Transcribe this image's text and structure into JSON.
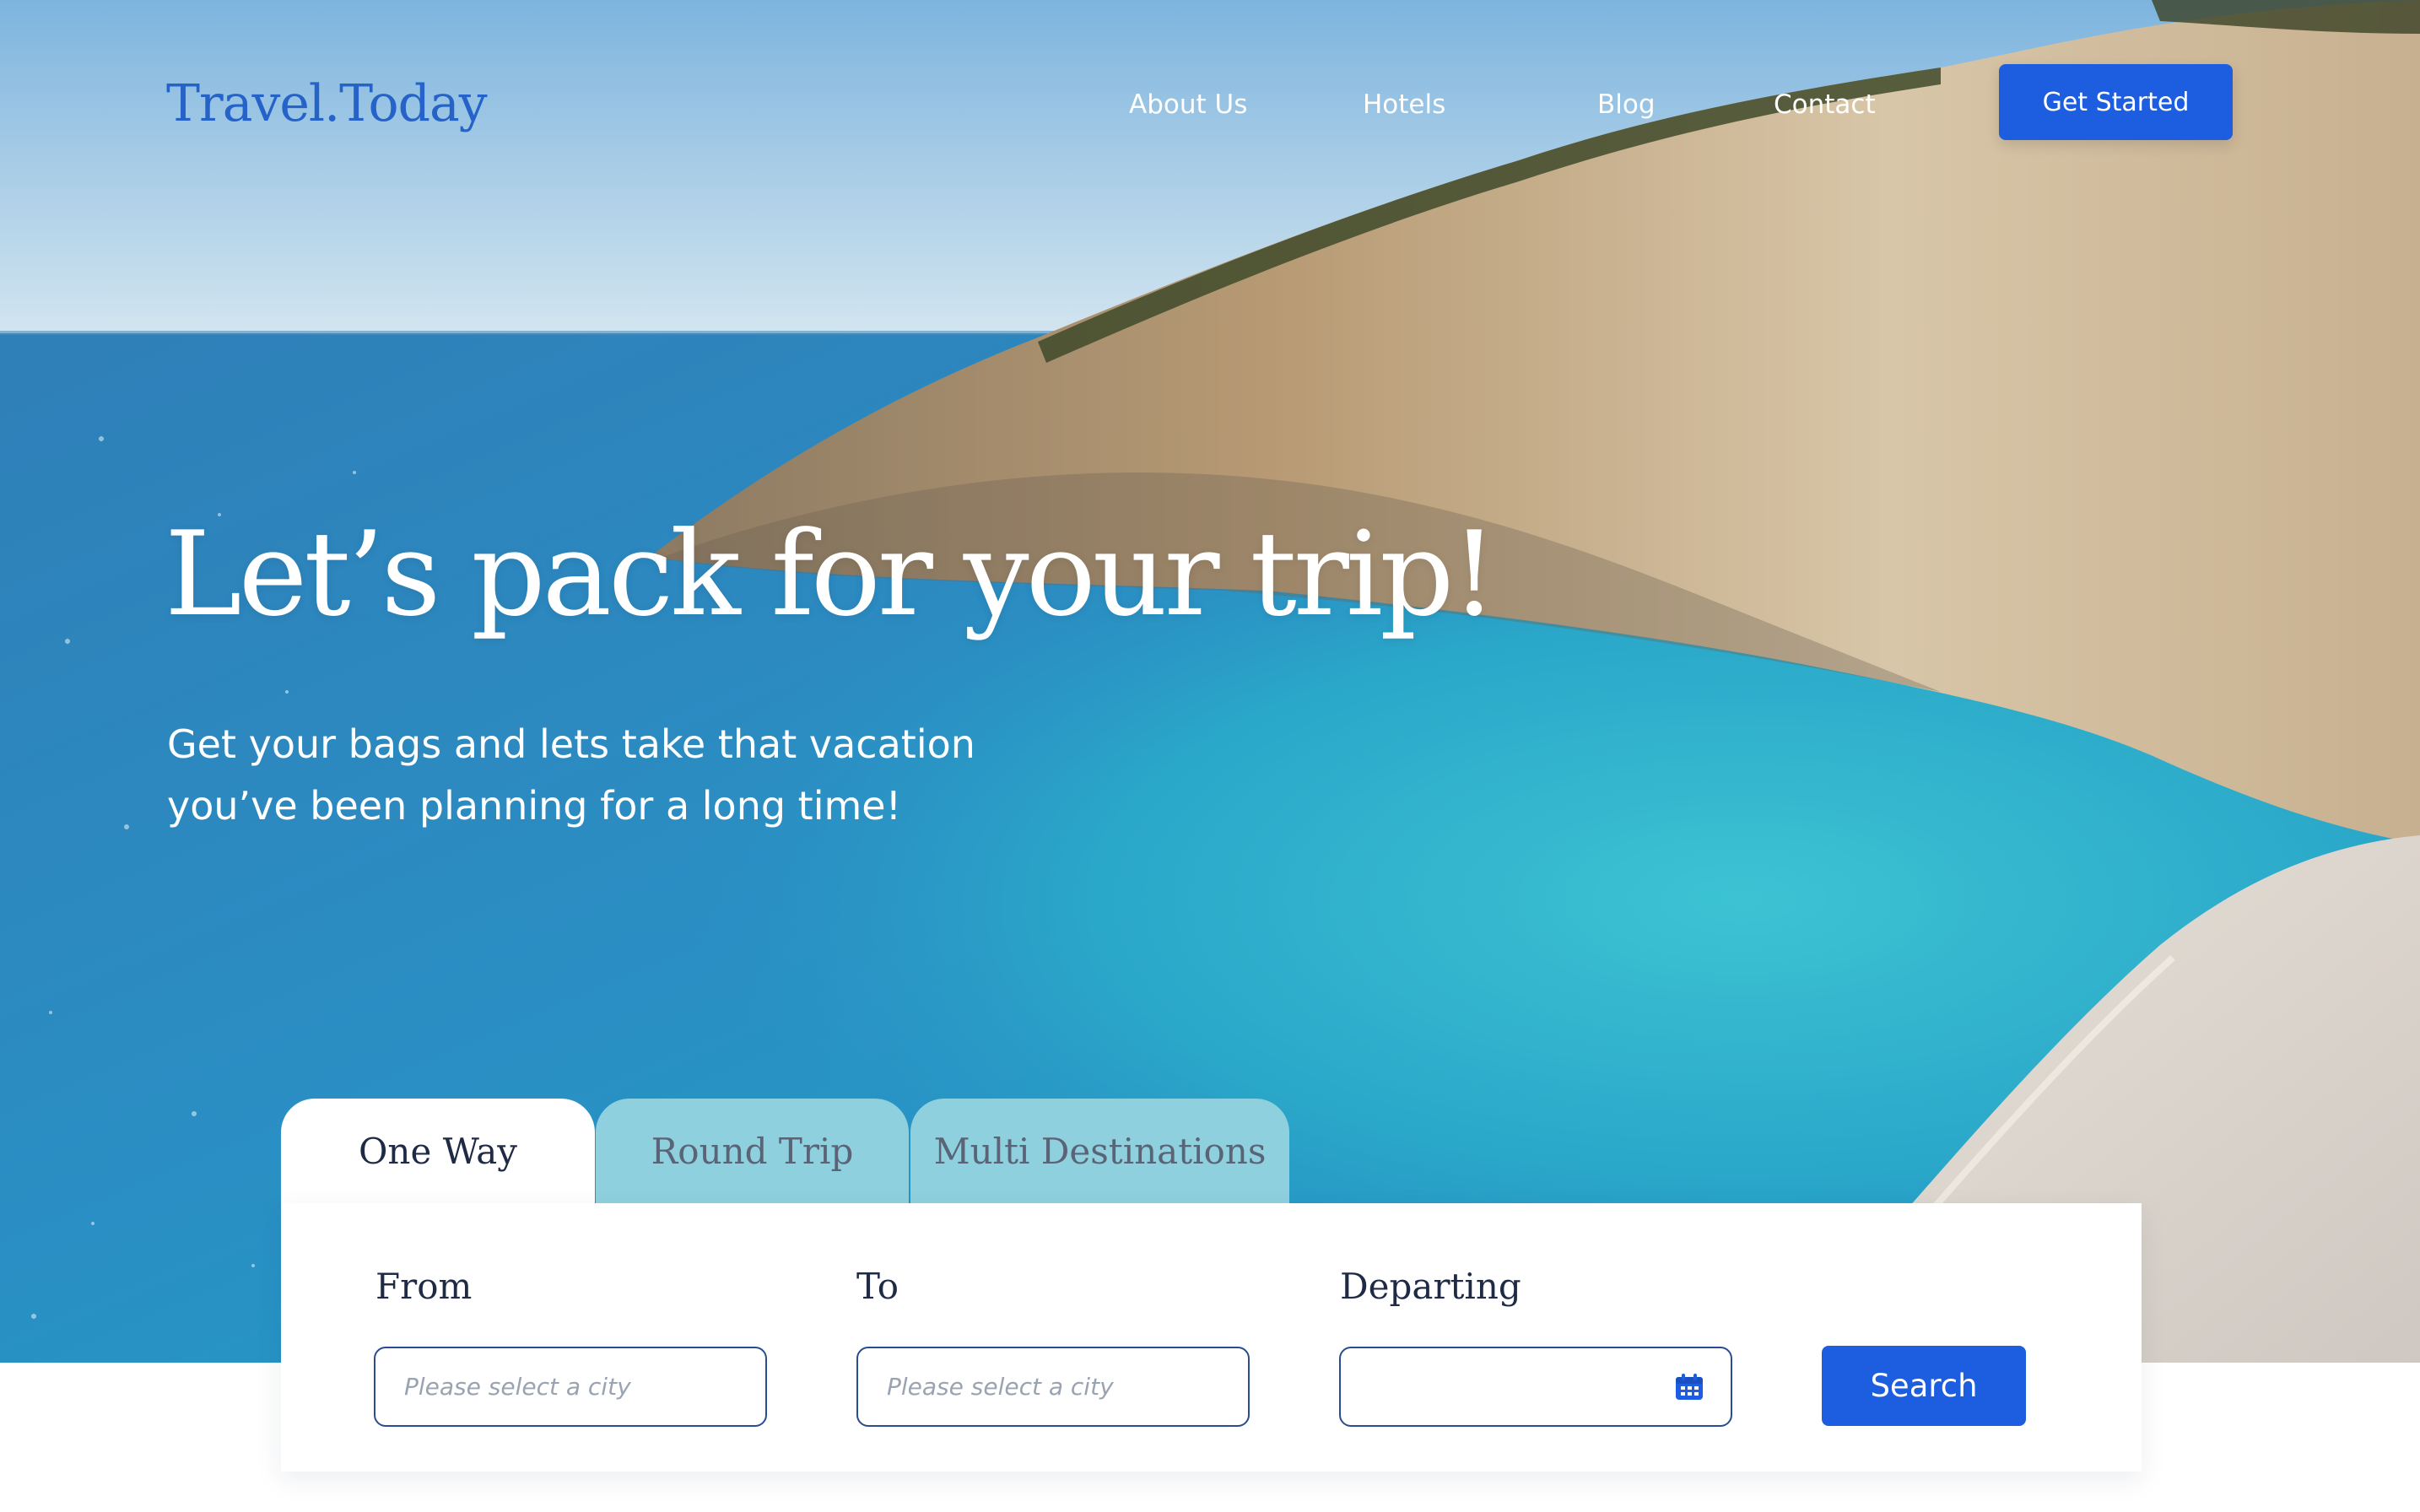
{
  "brand": {
    "logo_text": "Travel.Today",
    "accent_color": "#1d5ee0"
  },
  "nav": {
    "links": [
      {
        "label": "About Us"
      },
      {
        "label": "Hotels"
      },
      {
        "label": "Blog"
      },
      {
        "label": "Contact"
      }
    ],
    "cta_label": "Get Started"
  },
  "hero": {
    "headline": "Let’s pack for your trip!",
    "subline_1": "Get your bags and lets take that vacation",
    "subline_2": "you’ve been planning for a long time!"
  },
  "booking": {
    "tabs": [
      {
        "label": "One Way",
        "active": true
      },
      {
        "label": "Round Trip",
        "active": false
      },
      {
        "label": "Multi Destinations",
        "active": false
      }
    ],
    "from_label": "From",
    "from_placeholder": "Please select a city",
    "to_label": "To",
    "to_placeholder": "Please select a city",
    "departing_label": "Departing",
    "departing_value": "",
    "calendar_icon": "calendar-icon",
    "search_label": "Search"
  }
}
